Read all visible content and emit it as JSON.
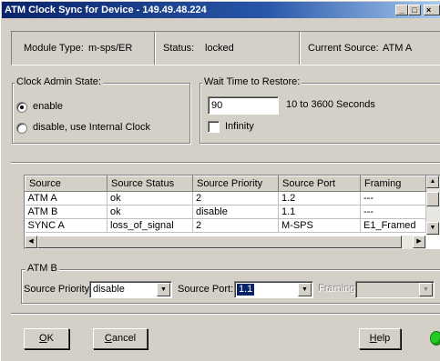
{
  "window": {
    "title": "ATM Clock Sync for Device - 149.49.48.224",
    "minimize_glyph": "_",
    "maximize_glyph": "□",
    "close_glyph": "×"
  },
  "info": {
    "module_type_label": "Module Type:",
    "module_type_value": "m-sps/ER",
    "status_label": "Status:",
    "status_value": "locked",
    "current_source_label": "Current Source:",
    "current_source_value": "ATM A"
  },
  "clock_admin": {
    "legend": "Clock Admin State:",
    "options": [
      {
        "label": "enable",
        "selected": true
      },
      {
        "label": "disable, use Internal Clock",
        "selected": false
      }
    ]
  },
  "wait_time": {
    "legend": "Wait Time to Restore:",
    "value": "90",
    "range_text": "10 to 3600 Seconds",
    "infinity_label": "Infinity",
    "infinity_checked": false
  },
  "table": {
    "columns": [
      "Source",
      "Source Status",
      "Source Priority",
      "Source Port",
      "Framing"
    ],
    "rows": [
      [
        "ATM  A",
        "ok",
        "2",
        "1.2",
        "---"
      ],
      [
        "ATM  B",
        "ok",
        "disable",
        "1.1",
        "---"
      ],
      [
        "SYNC A",
        "loss_of_signal",
        "2",
        "M-SPS",
        "E1_Framed"
      ]
    ],
    "scroll_up": "▲",
    "scroll_down": "▼",
    "scroll_left": "◀",
    "scroll_right": "▶"
  },
  "detail": {
    "legend": "ATM  B",
    "priority_label": "Source Priority:",
    "priority_value": "disable",
    "port_label": "Source Port:",
    "port_value": "1.1",
    "framing_label": "Framing:",
    "framing_value": "",
    "dropdown_glyph": "▼"
  },
  "buttons": {
    "ok_prefix": "O",
    "ok_rest": "K",
    "cancel_prefix": "C",
    "cancel_rest": "ancel",
    "help_prefix": "H",
    "help_rest": "elp"
  },
  "colors": {
    "status_indicator": "#22cc22",
    "selection": "#0a246a"
  }
}
